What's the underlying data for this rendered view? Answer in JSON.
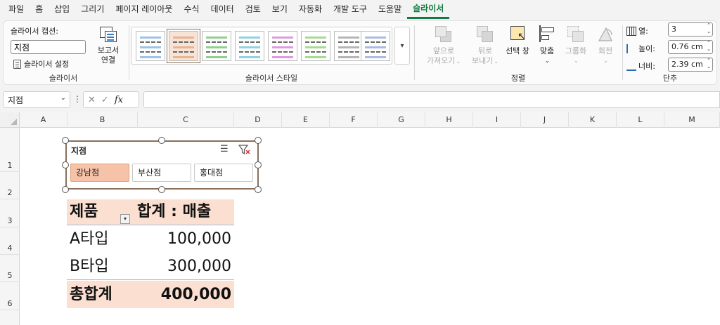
{
  "ribbon_tabs": [
    "파일",
    "홈",
    "삽입",
    "그리기",
    "페이지 레이아웃",
    "수식",
    "데이터",
    "검토",
    "보기",
    "자동화",
    "개발 도구",
    "도움말",
    "슬라이서"
  ],
  "active_tab": "슬라이서",
  "ribbon": {
    "slicer_group": {
      "caption_label": "슬라이서 캡션:",
      "caption_value": "지점",
      "settings_label": "슬라이서 설정",
      "label": "슬라이서"
    },
    "report_connections": {
      "line1": "보고서",
      "line2": "연결"
    },
    "styles_group": {
      "label": "슬라이서 스타일"
    },
    "arrange_group": {
      "label": "정렬",
      "bring_forward": {
        "line1": "앞으로",
        "line2": "가져오기"
      },
      "send_backward": {
        "line1": "뒤로",
        "line2": "보내기"
      },
      "selection_pane": "선택 창",
      "align": "맞춤",
      "group": "그룹화",
      "rotate": "회전"
    },
    "buttons_group": {
      "label": "단추",
      "columns_label": "열:",
      "columns_value": "3",
      "height_label": "높이:",
      "height_value": "0.76 cm",
      "width_label": "너비:",
      "width_value": "2.39 cm"
    }
  },
  "formula_bar": {
    "name_box": "지점",
    "formula": ""
  },
  "column_headers": [
    "A",
    "B",
    "C",
    "D",
    "E",
    "F",
    "G",
    "H",
    "I",
    "J",
    "K",
    "L",
    "M"
  ],
  "row_headers": [
    "1",
    "2",
    "3",
    "4",
    "5",
    "6"
  ],
  "slicer": {
    "title": "지점",
    "items": [
      {
        "label": "강남점",
        "selected": true
      },
      {
        "label": "부산점",
        "selected": false
      },
      {
        "label": "홍대점",
        "selected": false
      }
    ]
  },
  "pivot": {
    "header_product": "제품",
    "header_sum": "합계 : 매출",
    "rows": [
      {
        "product": "A타입",
        "value": "100,000"
      },
      {
        "product": "B타입",
        "value": "300,000"
      }
    ],
    "total_label": "총합계",
    "total_value": "400,000"
  },
  "colors": {
    "accent": "#107c41",
    "slicer_selected": "#f6c2a8",
    "pivot_header_fill": "#fbe0d2"
  }
}
